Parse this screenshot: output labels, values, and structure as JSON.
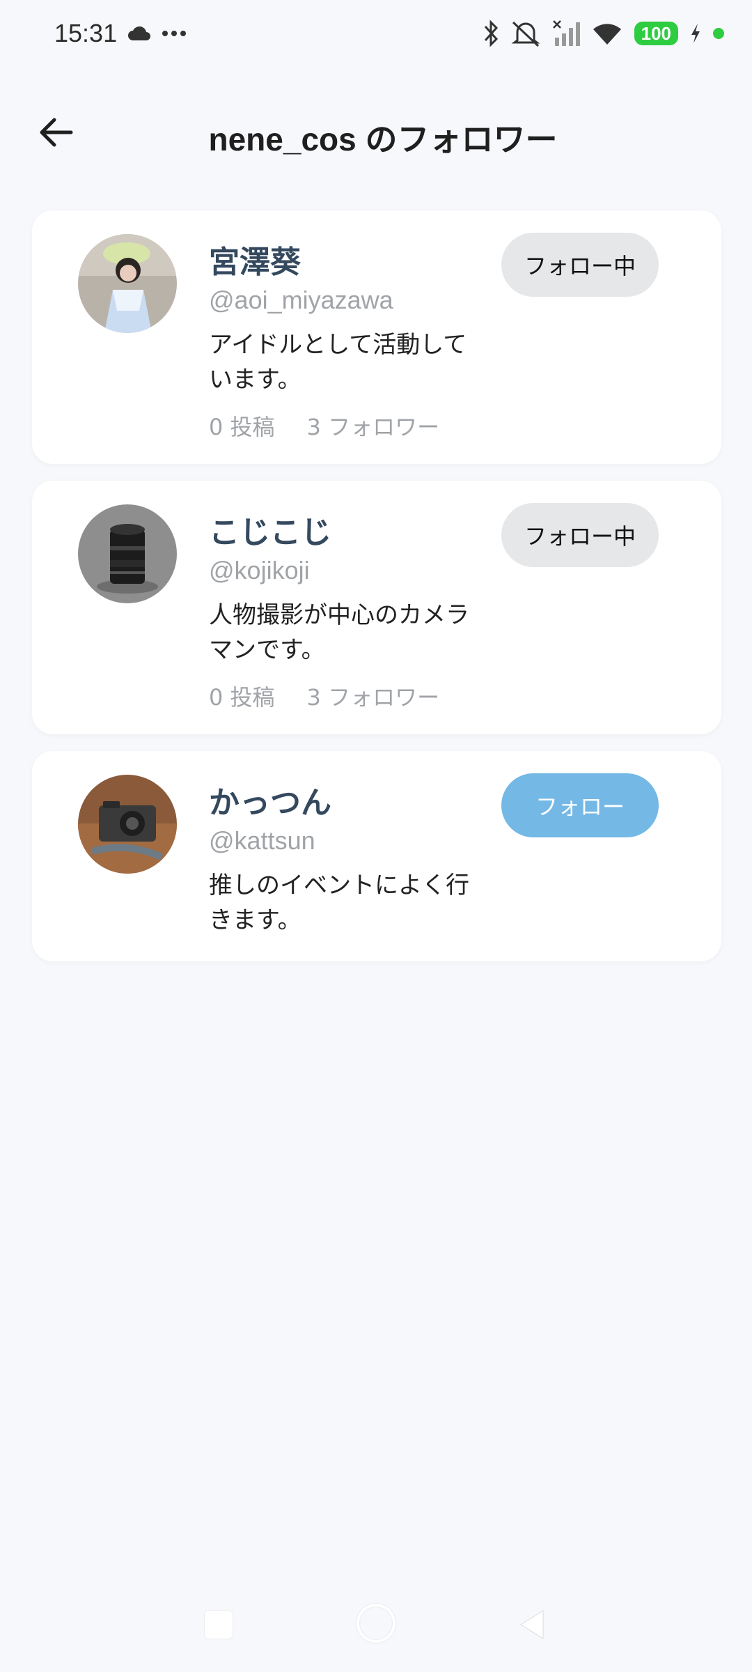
{
  "status_bar": {
    "time": "15:31",
    "battery": "100",
    "icons": [
      "cloud-icon",
      "more-dots-icon",
      "bluetooth-icon",
      "bell-off-icon",
      "signal-icon",
      "wifi-icon",
      "charging-icon"
    ]
  },
  "header": {
    "title": "nene_cos のフォロワー",
    "back_icon": "arrow-left-icon"
  },
  "followers": [
    {
      "name": "宮澤葵",
      "handle": "@aoi_miyazawa",
      "bio": "アイドルとして活動しています。",
      "posts": "0 投稿",
      "followers": "3 フォロワー",
      "button": "フォロー中",
      "avatar": "person-photo"
    },
    {
      "name": "こじこじ",
      "handle": "@kojikoji",
      "bio": "人物撮影が中心のカメラマンです。",
      "posts": "0 投稿",
      "followers": "3 フォロワー",
      "button": "フォロー中",
      "avatar": "camera-lens-photo"
    },
    {
      "name": "かっつん",
      "handle": "@kattsun",
      "bio": "推しのイベントによく行きます。",
      "button": "フォロー",
      "avatar": "camera-photo"
    }
  ],
  "colors": {
    "background": "#f7f8fb",
    "name": "#34495e",
    "muted": "#a0a4a8",
    "following_button": "#e6e7e8",
    "follow_button": "#74b8e6",
    "battery": "#2ecc40"
  }
}
